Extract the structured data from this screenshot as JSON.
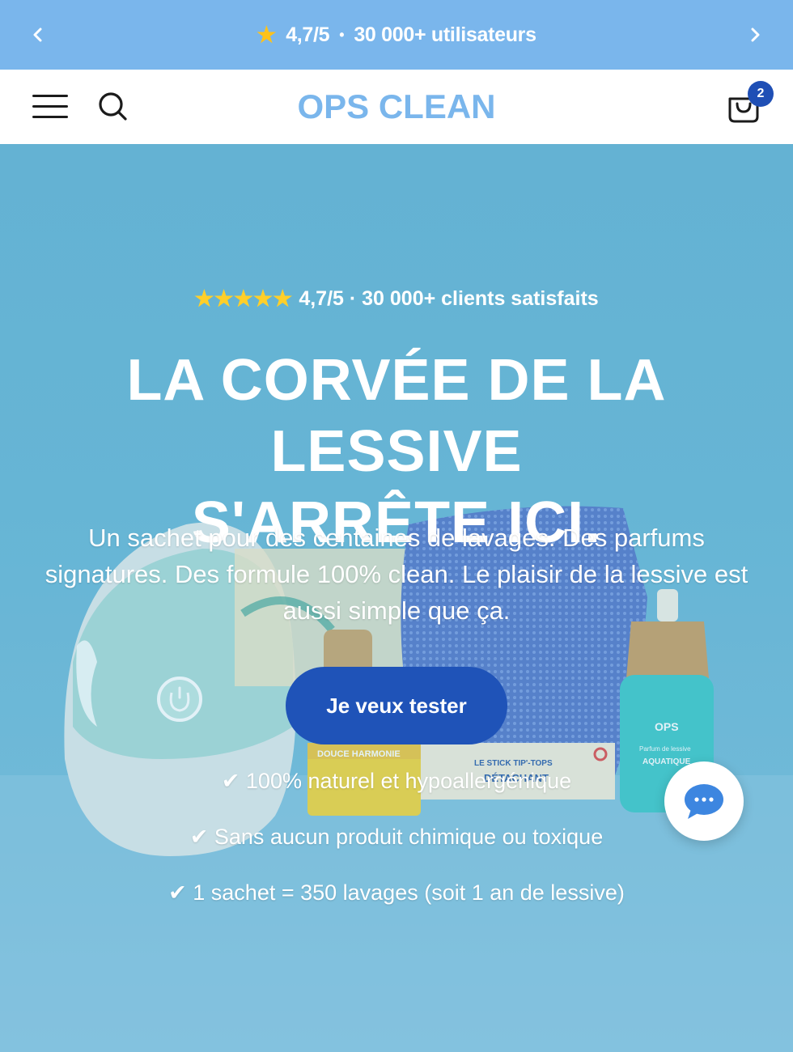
{
  "announcement": {
    "star_icon": "star-icon",
    "text_rating": "4,7/5",
    "separator": "•",
    "text_users": "30 000+ utilisateurs",
    "prev_icon": "chevron-left-icon",
    "next_icon": "chevron-right-icon"
  },
  "header": {
    "logo": "OPS CLEAN",
    "menu_icon": "hamburger-menu-icon",
    "search_icon": "search-icon",
    "cart_icon": "shopping-bag-icon",
    "cart_count": "2"
  },
  "hero": {
    "stars": "★★★★★",
    "rating_text": "4,7/5 · 30 000+ clients satisfaits",
    "headline_line1": "LA CORVÉE DE LA LESSIVE",
    "headline_line2": "S'ARRÊTE ICI.",
    "subtext": "Un sachet pour des centaines de lavages. Des parfums signatures. Des formule 100% clean. Le plaisir de la lessive est aussi simple que ça.",
    "cta_label": "Je veux tester",
    "benefits": [
      "✔ 100% naturel et hypoallergénique",
      "✔ Sans aucun produit chimique ou toxique",
      "✔ 1 sachet = 350 lavages (soit 1 an de lessive)"
    ],
    "product_labels": {
      "tube": "DOUCE HARMONIE",
      "stick": "LE STICK TIP'-TOPS",
      "stick_sub": "DÉTACHANT",
      "bottle_brand": "OPS",
      "bottle_line1": "Parfum de lessive",
      "bottle_line2": "AQUATIQUE"
    }
  },
  "chat": {
    "icon": "chat-bubble-icon"
  },
  "colors": {
    "announcement_bg": "#7ab6ec",
    "logo": "#7ab6ec",
    "cta_bg": "#1f53b8",
    "badge_bg": "#1f4fb5",
    "star": "#ffc21a"
  }
}
